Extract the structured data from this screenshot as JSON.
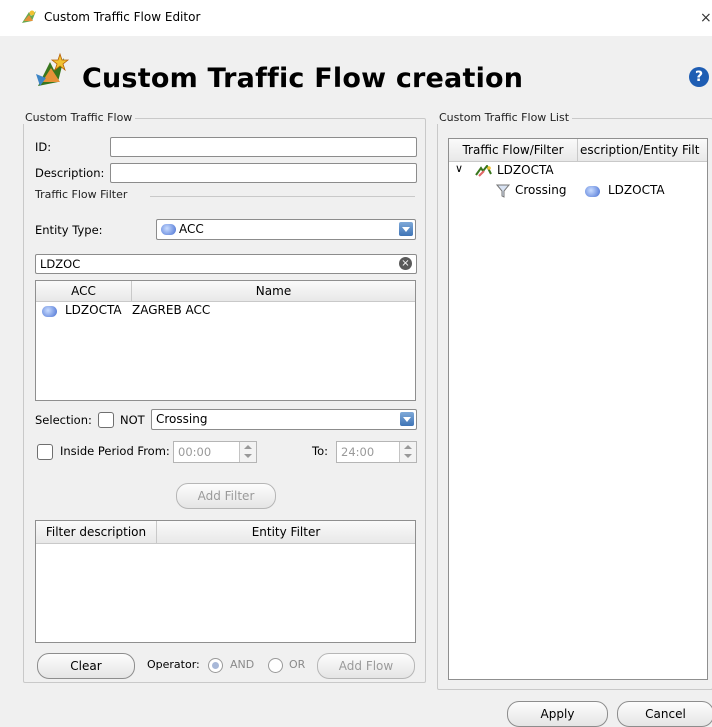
{
  "window": {
    "title": "Custom Traffic Flow Editor",
    "close_glyph": "×"
  },
  "header": {
    "title": "Custom Traffic Flow creation",
    "help_glyph": "?"
  },
  "ctf": {
    "legend": "Custom Traffic Flow",
    "id_label": "ID:",
    "id_value": "",
    "desc_label": "Description:",
    "desc_value": "",
    "filter_legend": "Traffic Flow Filter",
    "entity_type_label": "Entity Type:",
    "entity_type_value": "ACC",
    "search_value": "LDZOC",
    "entity_table": {
      "columns": [
        "ACC",
        "Name"
      ],
      "rows": [
        {
          "acc": "LDZOCTA",
          "name": "ZAGREB ACC"
        }
      ]
    },
    "selection_label": "Selection:",
    "not_label": "NOT",
    "selection_value": "Crossing",
    "inside_period_label": "Inside Period From:",
    "from_value": "00:00",
    "to_label": "To:",
    "to_value": "24:00",
    "add_filter_label": "Add Filter",
    "filter_table": {
      "columns": [
        "Filter description",
        "Entity Filter"
      ]
    },
    "clear_label": "Clear",
    "operator_label": "Operator:",
    "and_label": "AND",
    "or_label": "OR",
    "add_flow_label": "Add Flow"
  },
  "list": {
    "legend": "Custom Traffic Flow List",
    "columns": [
      "Traffic Flow/Filter",
      "escription/Entity Filt"
    ],
    "flow_name": "LDZOCTA",
    "filter_name": "Crossing",
    "filter_entity": "LDZOCTA"
  },
  "footer": {
    "apply_label": "Apply",
    "cancel_label": "Cancel"
  }
}
